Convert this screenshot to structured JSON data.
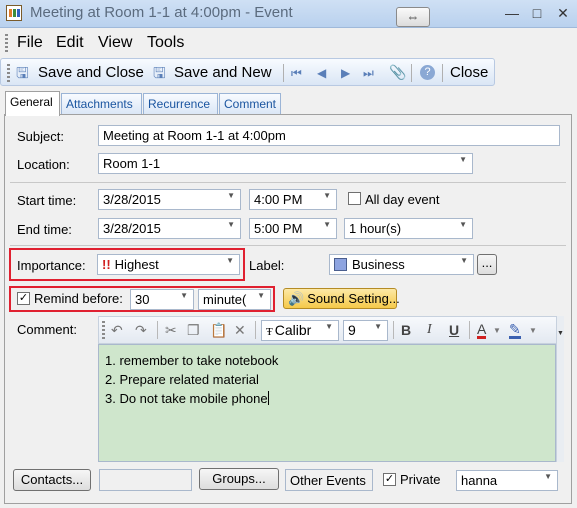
{
  "window": {
    "title": "Meeting at Room 1-1 at 4:00pm - Event",
    "swap_glyph": "⇔",
    "minimize": "—",
    "maximize": "□",
    "close": "✕"
  },
  "menu": [
    "File",
    "Edit",
    "View",
    "Tools"
  ],
  "toolbar": {
    "save_close": "Save and Close",
    "save_new": "Save and New",
    "close": "Close",
    "nav_first": "⏮",
    "nav_prev": "◀",
    "nav_next": "▶",
    "nav_last": "⏭",
    "attach": "📎",
    "help": "?"
  },
  "tabs": [
    "General",
    "Attachments",
    "Recurrence",
    "Comment"
  ],
  "form": {
    "subject_label": "Subject:",
    "subject_value": "Meeting at Room 1-1 at 4:00pm",
    "location_label": "Location:",
    "location_value": "Room 1-1",
    "start_label": "Start time:",
    "start_date": "3/28/2015",
    "start_time": "4:00 PM",
    "all_day_label": "All day event",
    "end_label": "End time:",
    "end_date": "3/28/2015",
    "end_time": "5:00 PM",
    "duration": "1 hour(s)",
    "importance_label": "Importance:",
    "importance_value": "Highest",
    "label_label": "Label:",
    "label_value": "Business",
    "label_color": "#8ea4e0",
    "label_more": "...",
    "remind_label": "Remind before:",
    "remind_value": "30",
    "remind_unit": "minute(",
    "sound_label": "Sound Setting...",
    "comment_label": "Comment:"
  },
  "editor": {
    "font": "Calibr",
    "size": "9",
    "bold": "B",
    "italic": "I",
    "underline": "U",
    "font_color_glyph": "A",
    "lines": [
      "1. remember to take notebook",
      "2. Prepare related material",
      "3. Do not take mobile phone"
    ]
  },
  "footer": {
    "contacts": "Contacts...",
    "groups": "Groups...",
    "other_events": "Other Events",
    "private_label": "Private",
    "owner": "hanna"
  },
  "colors": {
    "highlight_box": "#e02030",
    "comment_bg": "#cfe6cc",
    "sound_button": "#f5c94a"
  }
}
